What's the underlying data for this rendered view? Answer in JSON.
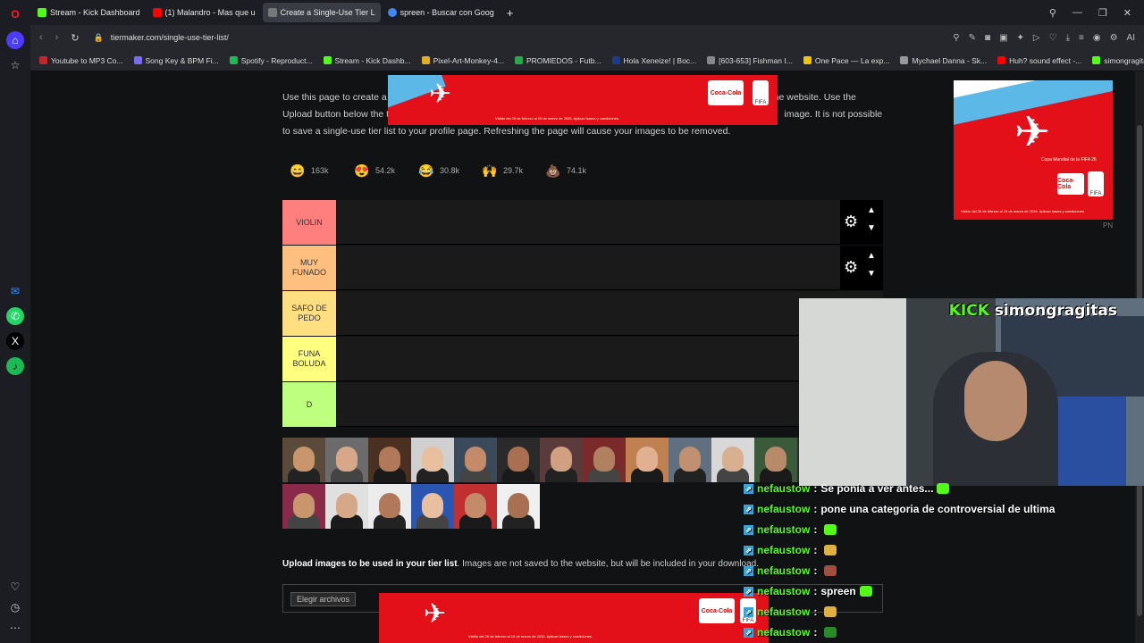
{
  "browser": {
    "tabs": [
      {
        "label": "Stream - Kick Dashboard",
        "color": "#53fc18"
      },
      {
        "label": "(1) Malandro - Mas que u",
        "color": "#ff0000"
      },
      {
        "label": "Create a Single-Use Tier L",
        "color": "#777777"
      },
      {
        "label": "spreen - Buscar con Goog",
        "color": "#4285f4"
      }
    ],
    "url": "tiermaker.com/single-use-tier-list/",
    "bookmarks": [
      {
        "label": "Youtube to MP3 Co...",
        "color": "#c1272d"
      },
      {
        "label": "Song Key & BPM Fi...",
        "color": "#7a6cf0"
      },
      {
        "label": "Spotify - Reproduct...",
        "color": "#1db954"
      },
      {
        "label": "Stream - Kick Dashb...",
        "color": "#53fc18"
      },
      {
        "label": "Pixel-Art-Monkey-4...",
        "color": "#e0b020"
      },
      {
        "label": "PROMIEDOS - Futb...",
        "color": "#2ba84a"
      },
      {
        "label": "Hola Xeneize! | Boc...",
        "color": "#1b3c8c"
      },
      {
        "label": "[603-653] Fishman I...",
        "color": "#888888"
      },
      {
        "label": "One Pace — La exp...",
        "color": "#f5c400"
      },
      {
        "label": "Mychael Danna - Sk...",
        "color": "#999999"
      },
      {
        "label": "Huh? sound effect -...",
        "color": "#ff0000"
      },
      {
        "label": "simongragitas - Kic...",
        "color": "#53fc18"
      }
    ]
  },
  "page": {
    "intro_1": "Use this page to create a",
    "intro_1b": "the website. Use the",
    "intro_2": "Upload button below the ti",
    "intro_2b": "image. It is not possible",
    "intro_3": "to save a single-use tier list to your profile page. Refreshing the page will cause your images to be removed.",
    "reactions": [
      {
        "emoji": "😄",
        "count": "163k"
      },
      {
        "emoji": "😍",
        "count": "54.2k"
      },
      {
        "emoji": "😂",
        "count": "30.8k"
      },
      {
        "emoji": "🙌",
        "count": "29.7k"
      },
      {
        "emoji": "💩",
        "count": "74.1k"
      }
    ],
    "tiers": [
      {
        "label": "VIOLIN",
        "color": "#ff7f7f"
      },
      {
        "label": "MUY FUNADO",
        "color": "#ffbf7f"
      },
      {
        "label": "SAFO DE PEDO",
        "color": "#ffdf7f"
      },
      {
        "label": "FUNA BOLUDA",
        "color": "#ffff7f"
      },
      {
        "label": "D",
        "color": "#bfff7f"
      }
    ],
    "upload_bold": "Upload images to be used in your tier list",
    "upload_rest": ". Images are not saved to the website, but will be included in your download.",
    "upload_button": "Elegir archivos"
  },
  "ads": {
    "brand": "Coca-Cola",
    "partner": "FIFA",
    "fine_print": "Válido del 26 de febrero al 15 de marzo de 2026. Aplican bases y condiciones.",
    "corner_tag": "PN",
    "right_tagline": "Copa Mundial de la FIFA 26"
  },
  "stream": {
    "overlay_brand": "KICK",
    "overlay_user": "simongragitas",
    "chat": [
      {
        "user": "nefaustow",
        "text": "Se ponía a ver antes..."
      },
      {
        "user": "nefaustow",
        "text": "pone una categoria de controversial de ultima"
      },
      {
        "user": "nefaustow",
        "text": ""
      },
      {
        "user": "nefaustow",
        "text": ""
      },
      {
        "user": "nefaustow",
        "text": ""
      },
      {
        "user": "nefaustow",
        "text": "spreen"
      },
      {
        "user": "nefaustow",
        "text": ""
      },
      {
        "user": "nefaustow",
        "text": ""
      }
    ]
  }
}
